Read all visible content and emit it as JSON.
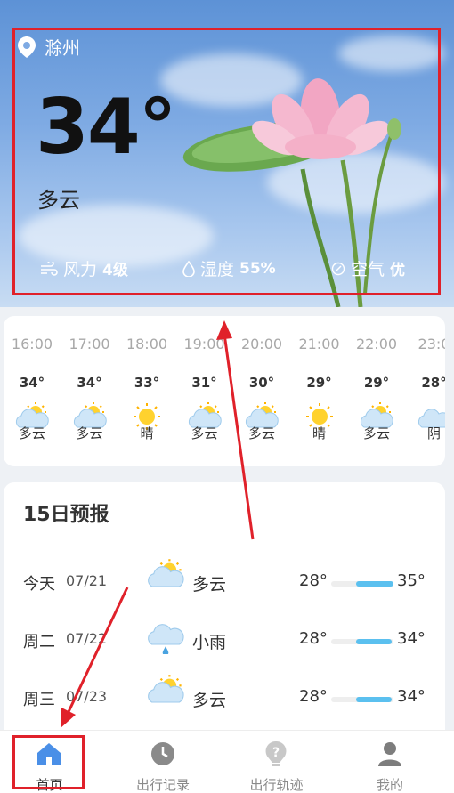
{
  "location": {
    "city": "滁州",
    "icon": "location-pin-icon"
  },
  "current": {
    "temperature": "34°",
    "condition": "多云"
  },
  "stats": {
    "wind_label": "风力",
    "wind_value": "4级",
    "humidity_label": "湿度",
    "humidity_value": "55%",
    "air_label": "空气",
    "air_value": "优"
  },
  "hourly": [
    {
      "time": "16:00",
      "temp": "34°",
      "cond": "多云",
      "icon": "partly-cloudy-icon"
    },
    {
      "time": "17:00",
      "temp": "34°",
      "cond": "多云",
      "icon": "partly-cloudy-icon"
    },
    {
      "time": "18:00",
      "temp": "33°",
      "cond": "晴",
      "icon": "sun-icon"
    },
    {
      "time": "19:00",
      "temp": "31°",
      "cond": "多云",
      "icon": "partly-cloudy-icon"
    },
    {
      "time": "20:00",
      "temp": "30°",
      "cond": "多云",
      "icon": "partly-cloudy-icon"
    },
    {
      "time": "21:00",
      "temp": "29°",
      "cond": "晴",
      "icon": "sun-icon"
    },
    {
      "time": "22:00",
      "temp": "29°",
      "cond": "多云",
      "icon": "partly-cloudy-icon"
    },
    {
      "time": "23:0",
      "temp": "28°",
      "cond": "阴",
      "icon": "cloud-icon"
    }
  ],
  "forecast": {
    "title": "15日预报",
    "rows": [
      {
        "day": "今天",
        "date": "07/21",
        "cond": "多云",
        "low": "28°",
        "high": "35°",
        "icon": "partly-cloudy-icon"
      },
      {
        "day": "周二",
        "date": "07/22",
        "cond": "小雨",
        "low": "28°",
        "high": "34°",
        "icon": "rain-icon"
      },
      {
        "day": "周三",
        "date": "07/23",
        "cond": "多云",
        "low": "28°",
        "high": "34°",
        "icon": "partly-cloudy-icon"
      }
    ]
  },
  "nav": [
    {
      "label": "首页",
      "icon": "home-icon",
      "active": true
    },
    {
      "label": "出行记录",
      "icon": "clock-icon",
      "active": false
    },
    {
      "label": "出行轨迹",
      "icon": "question-icon",
      "active": false
    },
    {
      "label": "我的",
      "icon": "person-icon",
      "active": false
    }
  ],
  "colors": {
    "accent": "#5bc0ef",
    "annotation": "#e0212a",
    "nav_active": "#3f8be8"
  }
}
